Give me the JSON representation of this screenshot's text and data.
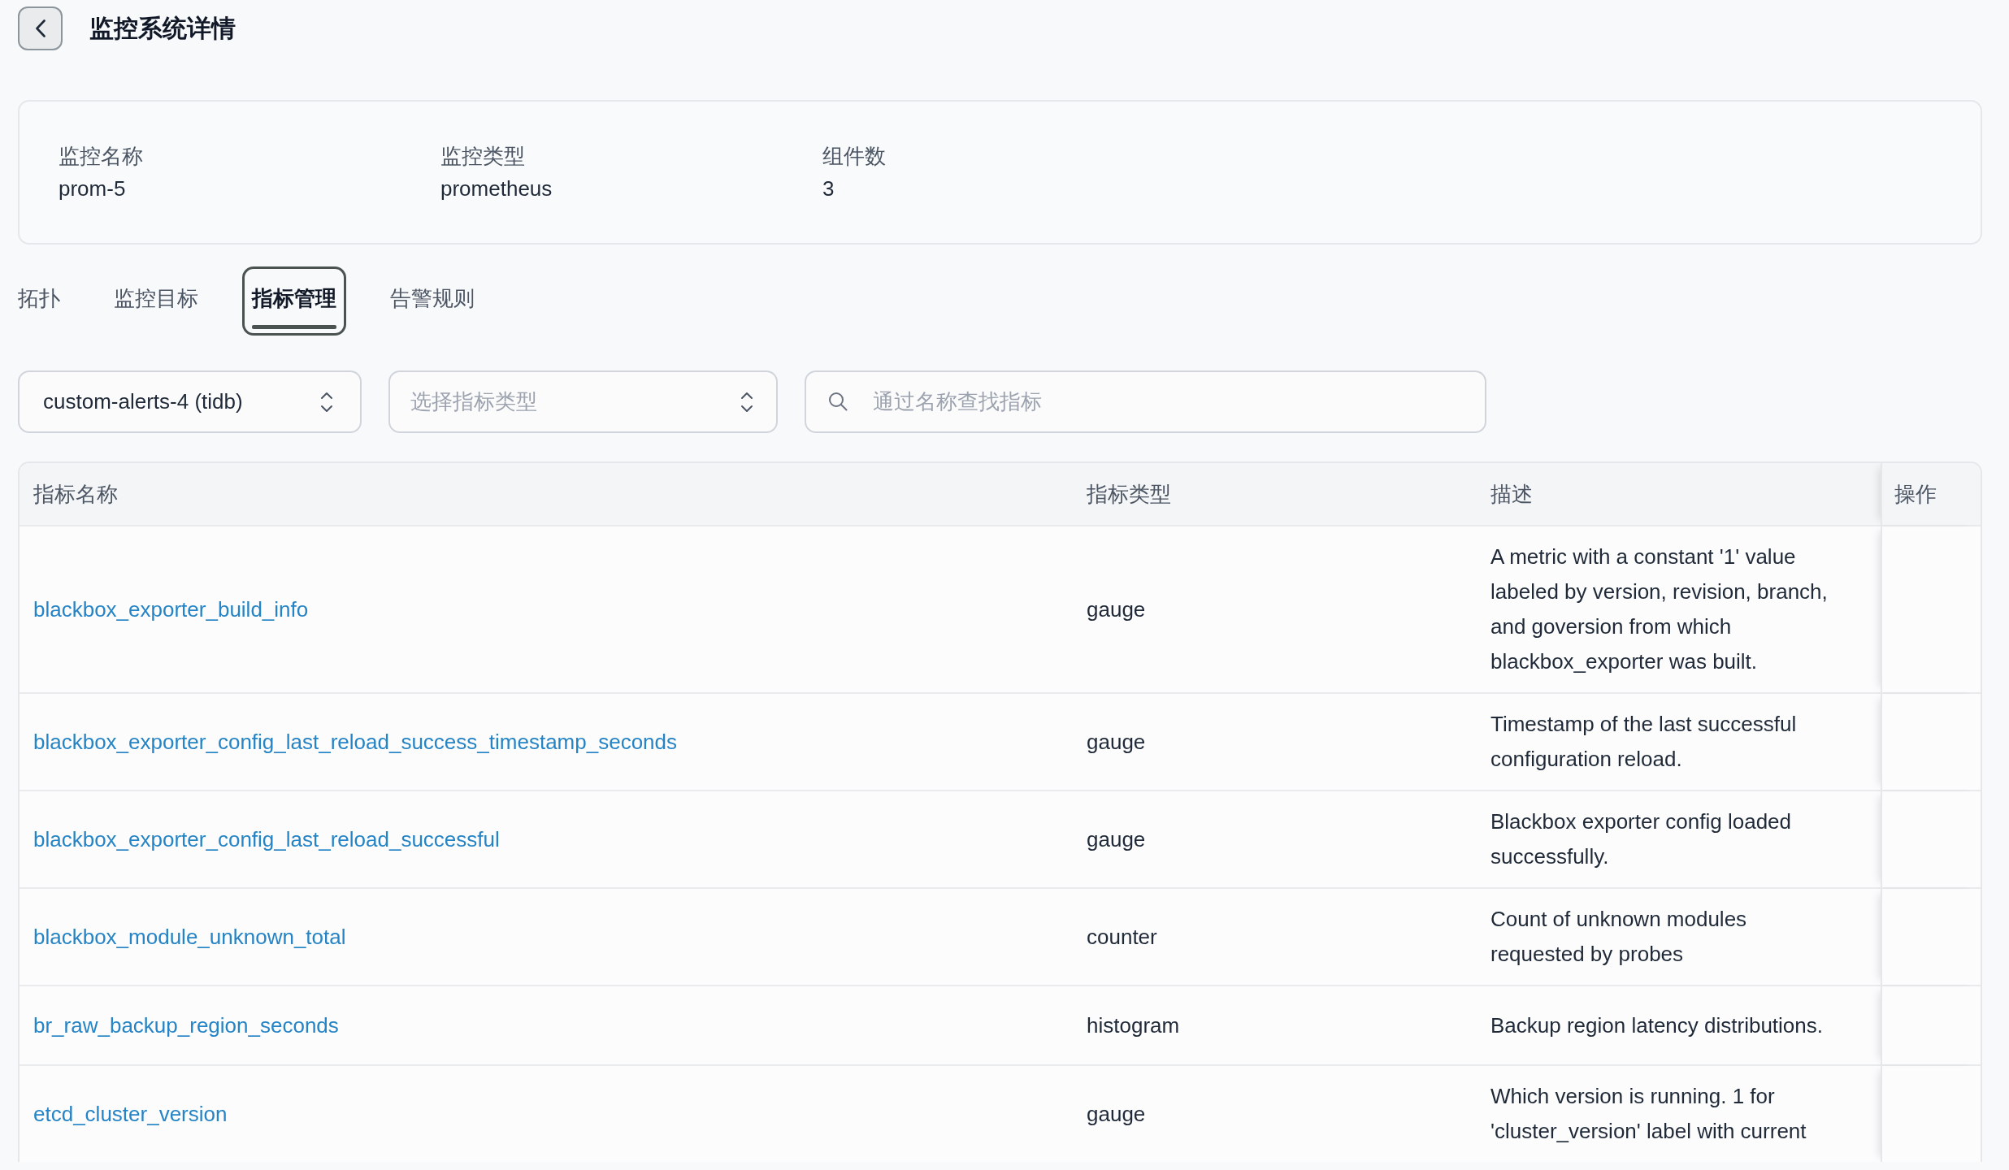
{
  "header": {
    "title": "监控系统详情"
  },
  "summary": [
    {
      "label": "监控名称",
      "value": "prom-5"
    },
    {
      "label": "监控类型",
      "value": "prometheus"
    },
    {
      "label": "组件数",
      "value": "3"
    }
  ],
  "tabs": [
    {
      "label": "拓扑",
      "selected": false
    },
    {
      "label": "监控目标",
      "selected": false
    },
    {
      "label": "指标管理",
      "selected": true
    },
    {
      "label": "告警规则",
      "selected": false
    }
  ],
  "filters": {
    "component_select": {
      "value": "custom-alerts-4 (tidb)"
    },
    "metric_type_select": {
      "placeholder": "选择指标类型"
    },
    "search": {
      "placeholder": "通过名称查找指标"
    }
  },
  "table": {
    "columns": [
      "指标名称",
      "指标类型",
      "描述",
      "操作"
    ],
    "rows": [
      {
        "name": "blackbox_exporter_build_info",
        "type": "gauge",
        "description": "A metric with a constant '1' value labeled by version, revision, branch, and goversion from which blackbox_exporter was built."
      },
      {
        "name": "blackbox_exporter_config_last_reload_success_timestamp_seconds",
        "type": "gauge",
        "description": "Timestamp of the last successful configuration reload."
      },
      {
        "name": "blackbox_exporter_config_last_reload_successful",
        "type": "gauge",
        "description": "Blackbox exporter config loaded successfully."
      },
      {
        "name": "blackbox_module_unknown_total",
        "type": "counter",
        "description": "Count of unknown modules requested by probes"
      },
      {
        "name": "br_raw_backup_region_seconds",
        "type": "histogram",
        "description": "Backup region latency distributions."
      },
      {
        "name": "etcd_cluster_version",
        "type": "gauge",
        "description": "Which version is running. 1 for 'cluster_version' label with current"
      }
    ]
  }
}
